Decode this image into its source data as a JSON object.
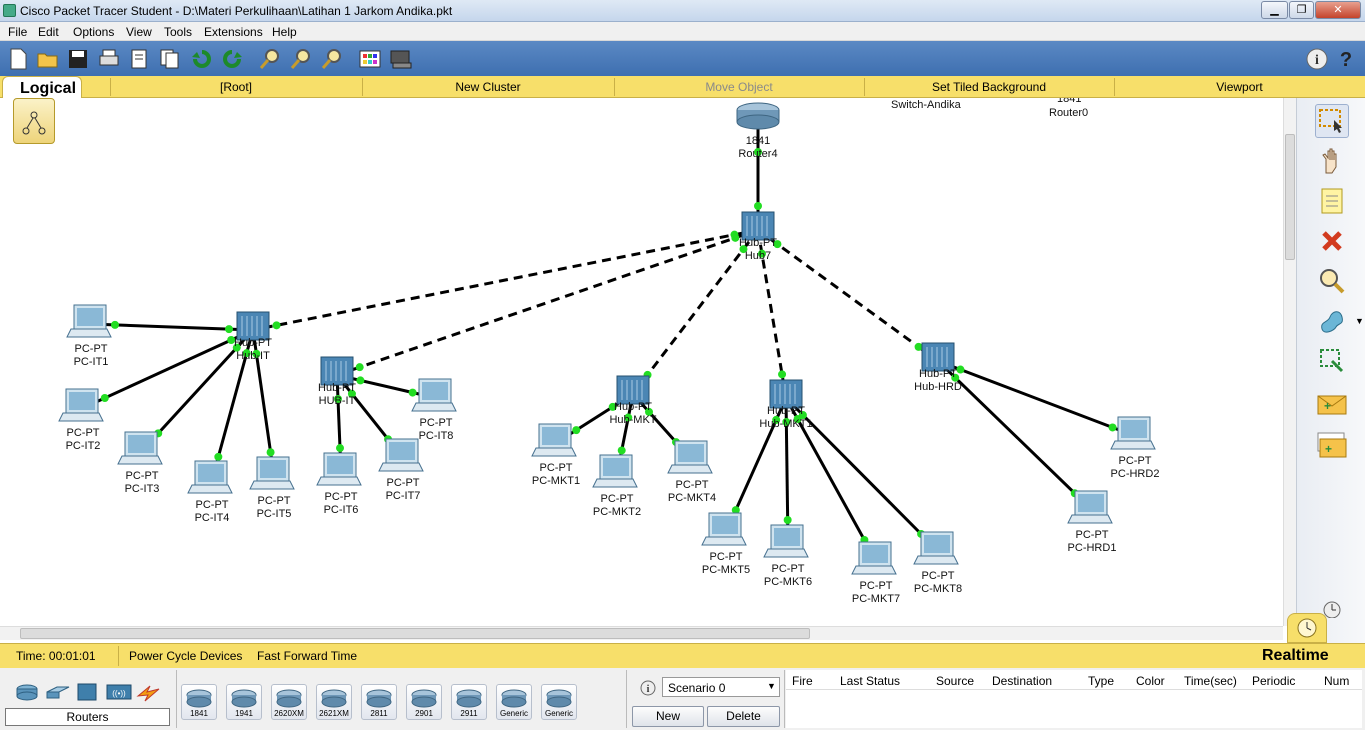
{
  "window": {
    "title": "Cisco Packet Tracer Student - D:\\Materi Perkulihaan\\Latihan 1 Jarkom Andika.pkt",
    "minimize": "▁",
    "maximize": "❐",
    "close": "✕"
  },
  "menu": [
    "File",
    "Edit",
    "Options",
    "View",
    "Tools",
    "Extensions",
    "Help"
  ],
  "toolbar_icons": [
    "new-icon",
    "open-icon",
    "save-icon",
    "print-icon",
    "wizard-icon",
    "copy-icon",
    "undo-icon",
    "redo-icon",
    "zoom-in-icon",
    "zoom-reset-icon",
    "zoom-out-icon",
    "palette-icon",
    "custom-device-icon",
    "info-icon",
    "help-icon"
  ],
  "workspace_bar": {
    "logical": "Logical",
    "root": "[Root]",
    "new_cluster": "New Cluster",
    "move_object": "Move Object",
    "set_tiled_background": "Set Tiled Background",
    "viewport": "Viewport"
  },
  "topology": {
    "clipped_labels": [
      "Switch-Andika",
      "Router0",
      "1841"
    ],
    "nodes": [
      {
        "id": "router4",
        "kind": "router",
        "model": "1841",
        "name": "Router4"
      },
      {
        "id": "hub7",
        "kind": "hub",
        "model": "Hub-PT",
        "name": "Hub7"
      },
      {
        "id": "hubit",
        "kind": "hub",
        "model": "Hub-PT",
        "name": "Hub-IT"
      },
      {
        "id": "hubit2",
        "kind": "hub",
        "model": "Hub-PT",
        "name": "HUB-IT"
      },
      {
        "id": "hubmkt",
        "kind": "hub",
        "model": "Hub-PT",
        "name": "Hub-MKT"
      },
      {
        "id": "hubmkt1",
        "kind": "hub",
        "model": "Hub-PT",
        "name": "Hub-MKT1"
      },
      {
        "id": "hubhrd",
        "kind": "hub",
        "model": "Hub-PT",
        "name": "Hub-HRD"
      },
      {
        "id": "pcit1",
        "kind": "pc",
        "model": "PC-PT",
        "name": "PC-IT1"
      },
      {
        "id": "pcit2",
        "kind": "pc",
        "model": "PC-PT",
        "name": "PC-IT2"
      },
      {
        "id": "pcit3",
        "kind": "pc",
        "model": "PC-PT",
        "name": "PC-IT3"
      },
      {
        "id": "pcit4",
        "kind": "pc",
        "model": "PC-PT",
        "name": "PC-IT4"
      },
      {
        "id": "pcit5",
        "kind": "pc",
        "model": "PC-PT",
        "name": "PC-IT5"
      },
      {
        "id": "pcit6",
        "kind": "pc",
        "model": "PC-PT",
        "name": "PC-IT6"
      },
      {
        "id": "pcit7",
        "kind": "pc",
        "model": "PC-PT",
        "name": "PC-IT7"
      },
      {
        "id": "pcit8",
        "kind": "pc",
        "model": "PC-PT",
        "name": "PC-IT8"
      },
      {
        "id": "pcmkt1",
        "kind": "pc",
        "model": "PC-PT",
        "name": "PC-MKT1"
      },
      {
        "id": "pcmkt2",
        "kind": "pc",
        "model": "PC-PT",
        "name": "PC-MKT2"
      },
      {
        "id": "pcmkt4",
        "kind": "pc",
        "model": "PC-PT",
        "name": "PC-MKT4"
      },
      {
        "id": "pcmkt5",
        "kind": "pc",
        "model": "PC-PT",
        "name": "PC-MKT5"
      },
      {
        "id": "pcmkt6",
        "kind": "pc",
        "model": "PC-PT",
        "name": "PC-MKT6"
      },
      {
        "id": "pcmkt7",
        "kind": "pc",
        "model": "PC-PT",
        "name": "PC-MKT7"
      },
      {
        "id": "pcmkt8",
        "kind": "pc",
        "model": "PC-PT",
        "name": "PC-MKT8"
      },
      {
        "id": "pchrd1",
        "kind": "pc",
        "model": "PC-PT",
        "name": "PC-HRD1"
      },
      {
        "id": "pchrd2",
        "kind": "pc",
        "model": "PC-PT",
        "name": "PC-HRD2"
      }
    ],
    "links": [
      {
        "from": "router4",
        "to": "hub7",
        "style": "solid"
      },
      {
        "from": "hub7",
        "to": "hubit",
        "style": "dashed"
      },
      {
        "from": "hub7",
        "to": "hubit2",
        "style": "dashed"
      },
      {
        "from": "hub7",
        "to": "hubmkt",
        "style": "dashed"
      },
      {
        "from": "hub7",
        "to": "hubmkt1",
        "style": "dashed"
      },
      {
        "from": "hub7",
        "to": "hubhrd",
        "style": "dashed"
      },
      {
        "from": "hubit",
        "to": "pcit1",
        "style": "solid"
      },
      {
        "from": "hubit",
        "to": "pcit2",
        "style": "solid"
      },
      {
        "from": "hubit",
        "to": "pcit3",
        "style": "solid"
      },
      {
        "from": "hubit",
        "to": "pcit4",
        "style": "solid"
      },
      {
        "from": "hubit",
        "to": "pcit5",
        "style": "solid"
      },
      {
        "from": "hubit2",
        "to": "pcit6",
        "style": "solid"
      },
      {
        "from": "hubit2",
        "to": "pcit7",
        "style": "solid"
      },
      {
        "from": "hubit2",
        "to": "pcit8",
        "style": "solid"
      },
      {
        "from": "hubmkt",
        "to": "pcmkt1",
        "style": "solid"
      },
      {
        "from": "hubmkt",
        "to": "pcmkt2",
        "style": "solid"
      },
      {
        "from": "hubmkt",
        "to": "pcmkt4",
        "style": "solid"
      },
      {
        "from": "hubmkt1",
        "to": "pcmkt5",
        "style": "solid"
      },
      {
        "from": "hubmkt1",
        "to": "pcmkt6",
        "style": "solid"
      },
      {
        "from": "hubmkt1",
        "to": "pcmkt7",
        "style": "solid"
      },
      {
        "from": "hubmkt1",
        "to": "pcmkt8",
        "style": "solid"
      },
      {
        "from": "hubhrd",
        "to": "pchrd1",
        "style": "solid"
      },
      {
        "from": "hubhrd",
        "to": "pchrd2",
        "style": "solid"
      }
    ],
    "link_color": "#000000",
    "port_color": "#22dd22"
  },
  "status": {
    "time": "Time: 00:01:01",
    "power_cycle": "Power Cycle Devices",
    "fast_forward": "Fast Forward Time",
    "realtime": "Realtime"
  },
  "device_panel": {
    "selected_category": "Routers",
    "models": [
      "1841",
      "1941",
      "2620XM",
      "2621XM",
      "2811",
      "2901",
      "2911",
      "Generic",
      "Generic"
    ]
  },
  "scenario": {
    "value": "Scenario 0",
    "new": "New",
    "delete": "Delete"
  },
  "pdu_table": {
    "headers": [
      "Fire",
      "Last Status",
      "Source",
      "Destination",
      "Type",
      "Color",
      "Time(sec)",
      "Periodic",
      "Num"
    ]
  }
}
